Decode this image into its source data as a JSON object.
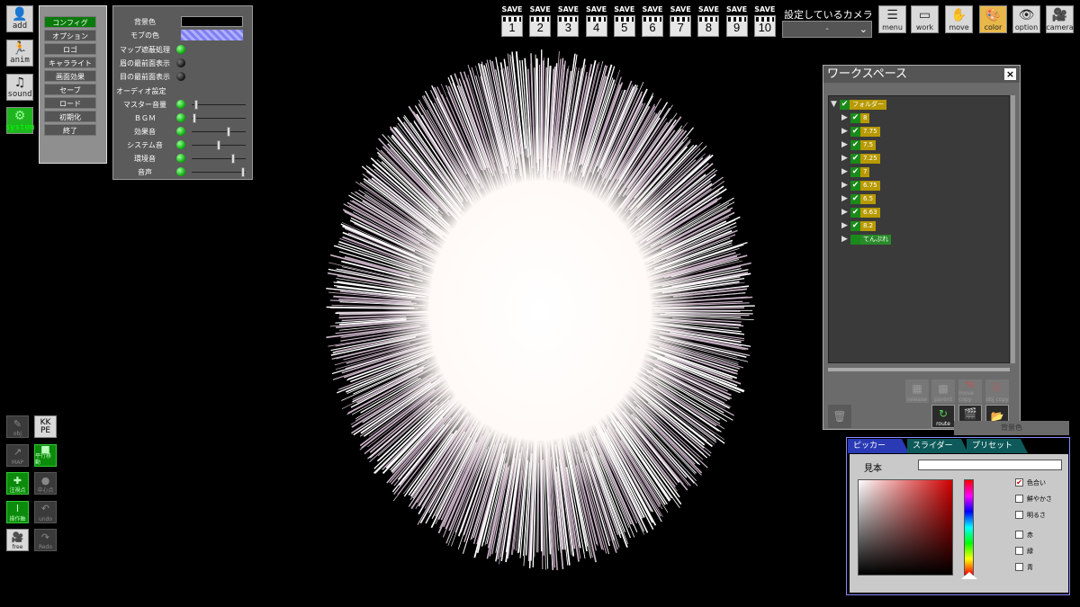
{
  "left_tools": [
    {
      "name": "add",
      "icon": "person-add-icon"
    },
    {
      "name": "anim",
      "icon": "running-figure-icon"
    },
    {
      "name": "sound",
      "icon": "music-note-icon"
    },
    {
      "name": "system",
      "icon": "gears-icon"
    }
  ],
  "system_menu": [
    "コンフィグ",
    "オプション",
    "ロゴ",
    "キャラライト",
    "画面効果",
    "セーブ",
    "ロード",
    "初期化",
    "終了"
  ],
  "config": {
    "bg_color_label": "背景色",
    "bg_color": "#000000",
    "mob_color_label": "モブの色",
    "mob_color": "#8080f0",
    "toggles": [
      {
        "label": "マップ遮蔽処理",
        "on": true
      },
      {
        "label": "眉の最前面表示",
        "on": false
      },
      {
        "label": "目の最前面表示",
        "on": false
      }
    ],
    "audio_heading": "オーディオ設定",
    "audio": [
      {
        "label": "マスター音量",
        "level": 0.05
      },
      {
        "label": "ＢＧＭ",
        "level": 0.02
      },
      {
        "label": "効果音",
        "level": 0.7
      },
      {
        "label": "システム音",
        "level": 0.5
      },
      {
        "label": "環境音",
        "level": 0.78
      },
      {
        "label": "音声",
        "level": 0.98
      }
    ]
  },
  "save_bar": {
    "label": "SAVE",
    "slots": [
      "1",
      "2",
      "3",
      "4",
      "5",
      "6",
      "7",
      "8",
      "9",
      "10"
    ]
  },
  "camera_select": {
    "label": "設定しているカメラ",
    "value": "-"
  },
  "top_tools": [
    {
      "name": "menu",
      "icon": "menu-list-icon"
    },
    {
      "name": "work",
      "icon": "work-frame-icon"
    },
    {
      "name": "move",
      "icon": "hand-icon"
    },
    {
      "name": "color",
      "icon": "palette-icon"
    },
    {
      "name": "option",
      "icon": "eye-icon"
    },
    {
      "name": "camera",
      "icon": "camera-icon"
    }
  ],
  "workspace": {
    "title": "ワークスペース",
    "close": "×",
    "root": "フォルダー",
    "items": [
      "8",
      "7.75",
      "7.5",
      "7.25",
      "7",
      "6.75",
      "6.5",
      "6.63",
      "8.2"
    ],
    "unchecked_item": "てんぷれ",
    "buttons": [
      "release",
      "parent",
      "move copy",
      "obj copy",
      "route",
      "camera"
    ]
  },
  "bottom_tools": [
    {
      "name": "obj",
      "style": "dim"
    },
    {
      "name": "KK PE",
      "style": "lt"
    },
    {
      "name": "MAP",
      "style": "dim"
    },
    {
      "name": "平行移動",
      "style": "gr"
    },
    {
      "name": "注視点",
      "style": "gr"
    },
    {
      "name": "中心点",
      "style": "dim"
    },
    {
      "name": "操作軸",
      "style": "gr"
    },
    {
      "name": "undo",
      "style": "dim"
    },
    {
      "name": "free",
      "style": "lt"
    },
    {
      "name": "Redo",
      "style": "dim"
    }
  ],
  "picker": {
    "title": "背景色",
    "tabs": [
      "ピッカー",
      "スライダー",
      "プリセット"
    ],
    "sample_label": "見本",
    "options_top": [
      {
        "label": "色合い",
        "checked": true
      },
      {
        "label": "鮮やかさ",
        "checked": false
      },
      {
        "label": "明るさ",
        "checked": false
      }
    ],
    "options_bottom": [
      {
        "label": "赤",
        "checked": false
      },
      {
        "label": "緑",
        "checked": false
      },
      {
        "label": "青",
        "checked": false
      }
    ]
  }
}
